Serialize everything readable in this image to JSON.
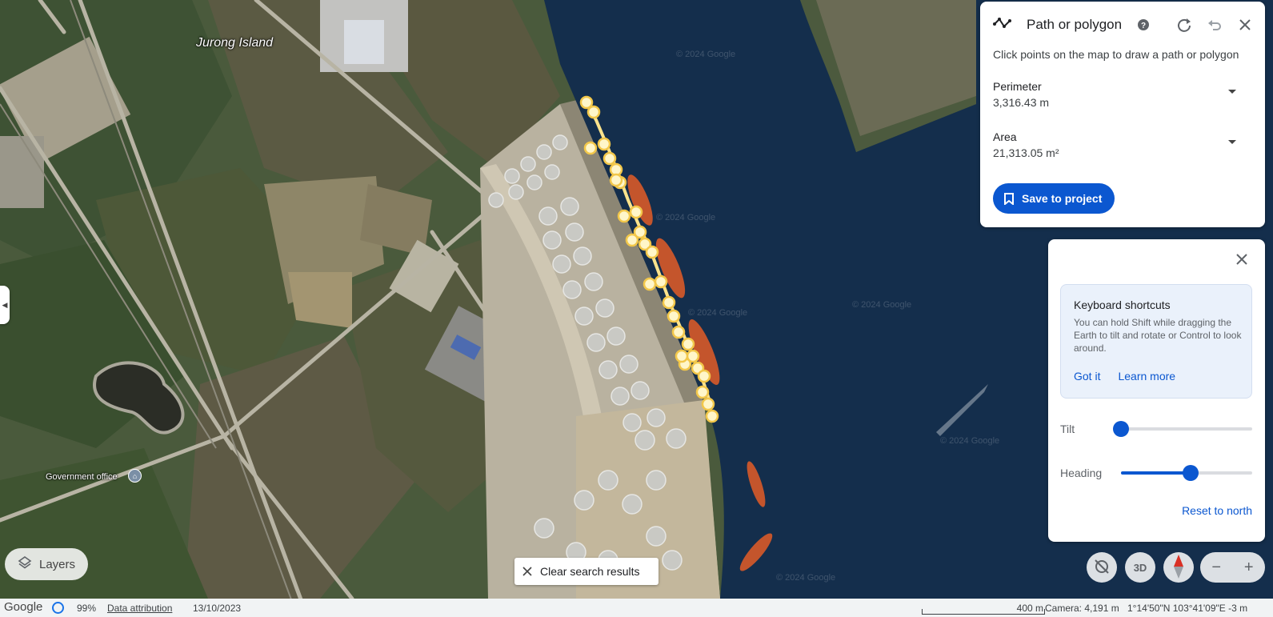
{
  "map": {
    "place_label": "Jurong Island",
    "poi_label": "Government office",
    "poi_icon": "government-building-icon",
    "watermark": "© 2024 Google"
  },
  "path_panel": {
    "icon": "path-polygon-icon",
    "title": "Path or polygon",
    "help_icon": "help-icon",
    "redo_icon": "redo-icon",
    "undo_icon": "undo-icon",
    "close_icon": "close-icon",
    "hint": "Click points on the map to draw a path or polygon",
    "perimeter": {
      "label": "Perimeter",
      "value": "3,316.43 m"
    },
    "area": {
      "label": "Area",
      "value": "21,313.05 m²"
    },
    "save_label": "Save to project",
    "save_icon": "bookmark-icon",
    "accent_color": "#0b57d0"
  },
  "shortcuts_panel": {
    "close_icon": "close-icon",
    "card_title": "Keyboard shortcuts",
    "card_text": "You can hold Shift while dragging the Earth to tilt and rotate or Control to look around.",
    "got_it": "Got it",
    "learn_more": "Learn more",
    "tilt_label": "Tilt",
    "tilt_value": 0,
    "heading_label": "Heading",
    "heading_value": 0.53,
    "reset_label": "Reset to north"
  },
  "controls": {
    "layers_label": "Layers",
    "layers_icon": "layers-icon",
    "clear_label": "Clear search results",
    "clear_icon": "close-icon",
    "view_3d_label": "3D",
    "compass_icon": "compass-icon",
    "no_tilt_icon": "tilt-off-icon",
    "zoom_out": "−",
    "zoom_in": "+"
  },
  "status_bar": {
    "logo": "Google",
    "loading_pct": "99%",
    "attribution": "Data attribution",
    "date": "13/10/2023",
    "scale": "400 m",
    "camera": "Camera: 4,191 m",
    "coordinates": "1°14'50\"N 103°41'09\"E   -3 m"
  }
}
